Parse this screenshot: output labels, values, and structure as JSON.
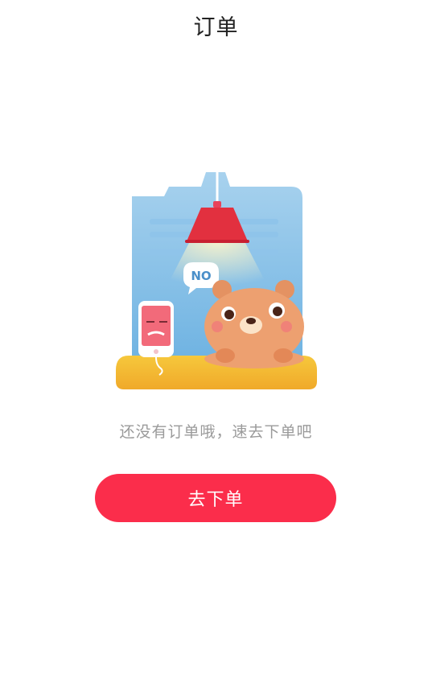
{
  "header": {
    "title": "订单"
  },
  "illustration": {
    "speech_bubble_text": "NO",
    "icon": "empty-orders-illustration"
  },
  "empty_state": {
    "message": "还没有订单哦，速去下单吧"
  },
  "action": {
    "button_label": "去下单"
  },
  "colors": {
    "accent": "#fb2d4b",
    "background": "#ffffff",
    "title_text": "#222222",
    "secondary_text": "#9a9a9a"
  }
}
